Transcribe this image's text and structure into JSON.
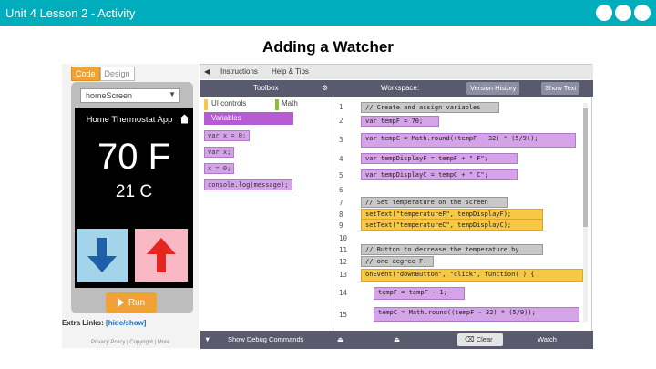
{
  "slide": {
    "header_title": "Unit 4 Lesson 2 - Activity",
    "heading": "Adding a Watcher"
  },
  "colors": {
    "brand_bar": "#00adbc",
    "run_button": "#f0a236",
    "variables_category": "#b45cd2"
  },
  "app": {
    "mode_code": "Code",
    "mode_design": "Design",
    "screen_select": "homeScreen",
    "screen_title": "Home Thermostat App",
    "temp_f": "70 F",
    "temp_c": "21 C",
    "run_label": "Run",
    "extra_links_label": "Extra Links:",
    "hide_show": "[hide/show]",
    "privacy": "Privacy Policy  |  Copyright  |  More"
  },
  "ide": {
    "tab_instructions": "Instructions",
    "tab_help": "Help & Tips",
    "toolbox_label": "Toolbox",
    "workspace_label": "Workspace:",
    "version_history": "Version History",
    "show_text": "Show Text",
    "categories": {
      "ui": "UI controls",
      "math": "Math",
      "variables": "Variables"
    },
    "toolbox_blocks": [
      "var x = 0;",
      "var x;",
      "x = 0;",
      "console.log(message);"
    ],
    "line_numbers": [
      "1",
      "2",
      "3",
      "4",
      "5",
      "6",
      "7",
      "8",
      "9",
      "10",
      "11",
      "12",
      "13",
      "14",
      "15"
    ],
    "code_lines": [
      "// Create and assign variables",
      "var tempF = 70;",
      "var tempC = Math.round((tempF - 32) * (5/9));",
      "var tempDisplayF = tempF + \" F\";",
      "var tempDisplayC = tempC + \" C\";",
      "",
      "// Set temperature on the screen",
      "setText(\"temperatureF\", tempDisplayF);",
      "setText(\"temperatureC\", tempDisplayC);",
      "",
      "// Button to decrease the temperature by",
      "// one degree F.",
      "onEvent(\"downButton\", \"click\", function( ) {",
      "tempF = tempF - 1;",
      "tempC = Math.round((tempF - 32) * (5/9));"
    ],
    "show_debug": "Show Debug Commands",
    "clear_label": "Clear",
    "watch_label": "Watch"
  }
}
